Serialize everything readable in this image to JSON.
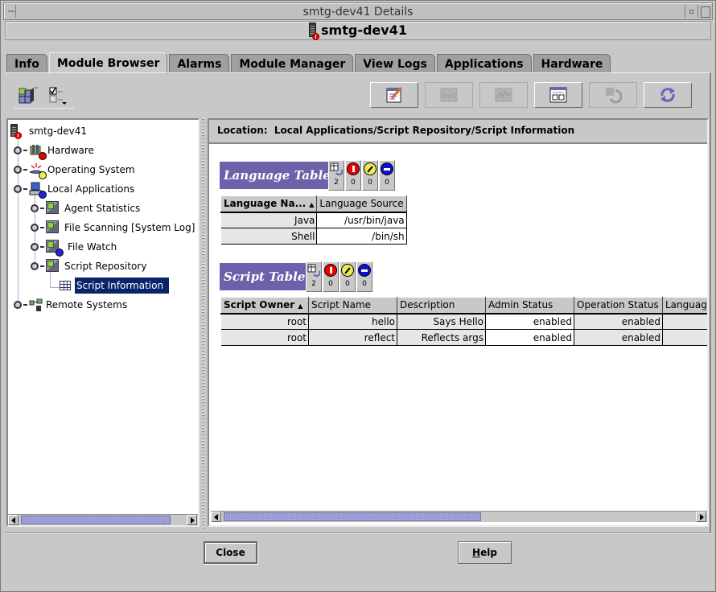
{
  "window": {
    "title": "smtg-dev41 Details",
    "header_title": "smtg-dev41"
  },
  "tabs": [
    {
      "label": "Info",
      "active": false
    },
    {
      "label": "Module Browser",
      "active": true
    },
    {
      "label": "Alarms",
      "active": false
    },
    {
      "label": "Module Manager",
      "active": false
    },
    {
      "label": "View Logs",
      "active": false
    },
    {
      "label": "Applications",
      "active": false
    },
    {
      "label": "Hardware",
      "active": false
    }
  ],
  "toolbar": {
    "left": [
      "module-select-icon",
      "view-options-icon"
    ],
    "buttons": [
      {
        "icon": "edit-pencil-icon",
        "enabled": true
      },
      {
        "icon": "probe-n1-icon",
        "enabled": false
      },
      {
        "icon": "graph-icon",
        "enabled": false
      },
      {
        "icon": "table-view-icon",
        "enabled": true
      },
      {
        "icon": "refresh-disabled-icon",
        "enabled": false
      },
      {
        "icon": "refresh-icon",
        "enabled": true
      }
    ]
  },
  "tree": {
    "root": "smtg-dev41",
    "items": [
      {
        "label": "Hardware",
        "level": 1,
        "badge": "red"
      },
      {
        "label": "Operating System",
        "level": 1,
        "badge": "yellow"
      },
      {
        "label": "Local Applications",
        "level": 1,
        "badge": "blue",
        "expanded": true
      },
      {
        "label": "Agent Statistics",
        "level": 2
      },
      {
        "label": "File Scanning [System Log]",
        "level": 2
      },
      {
        "label": "File Watch",
        "level": 2,
        "badge": "blue"
      },
      {
        "label": "Script Repository",
        "level": 2,
        "expanded": true
      },
      {
        "label": "Script Information",
        "level": 3,
        "selected": true
      },
      {
        "label": "Remote Systems",
        "level": 1
      }
    ]
  },
  "location": {
    "label": "Location:",
    "path": "Local Applications/Script Repository/Script Information"
  },
  "language_table": {
    "title": "Language Table",
    "badges": {
      "rows": "2",
      "critical": "0",
      "alert": "0",
      "down": "0"
    },
    "columns": [
      "Language Na...",
      "Language Source"
    ],
    "rows": [
      [
        "Java",
        "/usr/bin/java"
      ],
      [
        "Shell",
        "/bin/sh"
      ]
    ]
  },
  "script_table": {
    "title": "Script Table",
    "badges": {
      "rows": "2",
      "critical": "0",
      "alert": "0",
      "down": "0"
    },
    "columns": [
      "Script Owner",
      "Script Name",
      "Description",
      "Admin Status",
      "Operation Status",
      "Language"
    ],
    "rows": [
      [
        "root",
        "hello",
        "Says Hello",
        "enabled",
        "enabled",
        ""
      ],
      [
        "root",
        "reflect",
        "Reflects args",
        "enabled",
        "enabled",
        ""
      ]
    ]
  },
  "buttons": {
    "close": "Close",
    "help_first": "H",
    "help_rest": "elp"
  },
  "colors": {
    "section_title_bg": "#6b62aa",
    "selection_bg": "#0a246a",
    "scroll_thumb": "#9999d6"
  }
}
